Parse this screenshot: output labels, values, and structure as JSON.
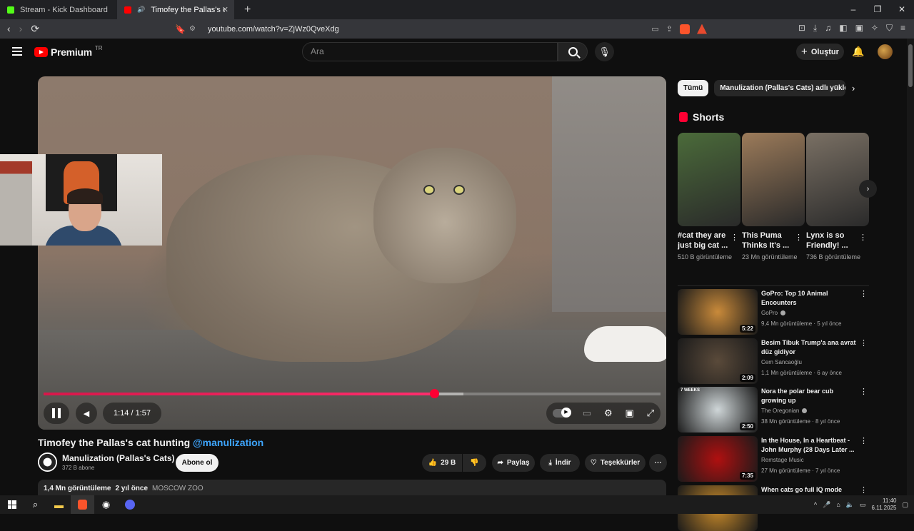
{
  "browser": {
    "tabs": [
      {
        "label": "Stream - Kick Dashboard",
        "color": "#53fc18"
      },
      {
        "label": "Timofey the Pallas's cat huntin",
        "color": "#ff0000"
      }
    ],
    "new_tab_glyph": "+",
    "window_controls": [
      "–",
      "❐",
      "✕"
    ],
    "url": "youtube.com/watch?v=ZjWz0QveXdg",
    "alert_count": "1"
  },
  "header": {
    "logo_text": "Premium",
    "country": "TR",
    "search_placeholder": "Ara",
    "create_label": "Oluştur"
  },
  "player": {
    "time": "1:14 / 1:57",
    "progress_fraction": 0.633,
    "buffered_fraction": 0.68
  },
  "video": {
    "title": "Timofey the Pallas's cat hunting",
    "handle": "@manulization",
    "channel": "Manulization (Pallas's Cats)",
    "subscribers": "372 B abone",
    "subscribe_label": "Abone ol",
    "likes": "29 B",
    "share_label": "Paylaş",
    "download_label": "İndir",
    "thanks_label": "Teşekkürler",
    "views": "1,4 Mn görüntüleme",
    "age": "2 yıl önce",
    "tag": "MOSCOW ZOO"
  },
  "sidebar": {
    "chips": [
      "Tümü",
      "Manulization (Pallas's Cats) adlı yükleyicide"
    ],
    "shorts_title": "Shorts",
    "shorts": [
      {
        "title": "#cat they are just big cat ...",
        "views": "510 B görüntüleme",
        "color": "#4b6b3a"
      },
      {
        "title": "This Puma Thinks It's ...",
        "views": "23 Mn görüntüleme",
        "color": "#9c7b5a"
      },
      {
        "title": "Lynx is so Friendly! ...",
        "views": "736 B görüntüleme",
        "color": "#7a7064"
      }
    ],
    "recommended": [
      {
        "title": "GoPro: Top 10 Animal Encounters",
        "channel": "GoPro",
        "meta": "9,4 Mn görüntüleme · 5 yıl önce",
        "duration": "5:22",
        "color": "#c98a3a",
        "verified": true
      },
      {
        "title": "Besim Tibuk Trump'a ana avrat düz gidiyor",
        "channel": "Cem Sancaoğlu",
        "meta": "1,1 Mn görüntüleme · 6 ay önce",
        "duration": "2:09",
        "color": "#5a4a3a",
        "verified": false
      },
      {
        "title": "Nora the polar bear cub growing up",
        "channel": "The Oregonian",
        "meta": "38 Mn görüntüleme · 8 yıl önce",
        "duration": "2:50",
        "color": "#cfd6d8",
        "verified": true,
        "thumb_text": "7 WEEKS"
      },
      {
        "title": "In the House, In a Heartbeat - John Murphy (28 Days Later ...",
        "channel": "Remstage Music",
        "meta": "27 Mn görüntüleme · 7 yıl önce",
        "duration": "7:35",
        "color": "#b01010",
        "verified": false
      },
      {
        "title": "When cats go full IQ mode",
        "channel": "",
        "meta": "",
        "duration": "",
        "color": "#c88a2a",
        "verified": false
      }
    ]
  },
  "taskbar": {
    "time": "11:40",
    "date": "6.11.2025"
  }
}
